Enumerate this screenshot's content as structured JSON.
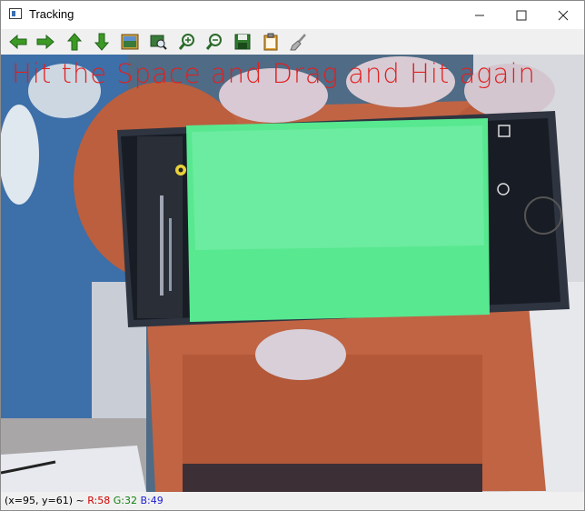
{
  "window": {
    "title": "Tracking"
  },
  "controls": {
    "minimize": "—",
    "maximize": "☐",
    "close": "✕"
  },
  "toolbar": {
    "icons": [
      "arrow-left-icon",
      "arrow-right-icon",
      "arrow-up-icon",
      "arrow-down-icon",
      "image-icon",
      "fit-icon",
      "zoom-in-icon",
      "zoom-out-icon",
      "save-icon",
      "clipboard-icon",
      "brush-icon"
    ]
  },
  "canvas": {
    "overlay_text": "Hit the Space and Drag and Hit again"
  },
  "status": {
    "coords": "(x=95, y=61) ~ ",
    "r": "R:58",
    "g": "G:32",
    "b": "B:49"
  },
  "colors": {
    "overlay": "#e02020",
    "screen_green": "#58e890"
  }
}
